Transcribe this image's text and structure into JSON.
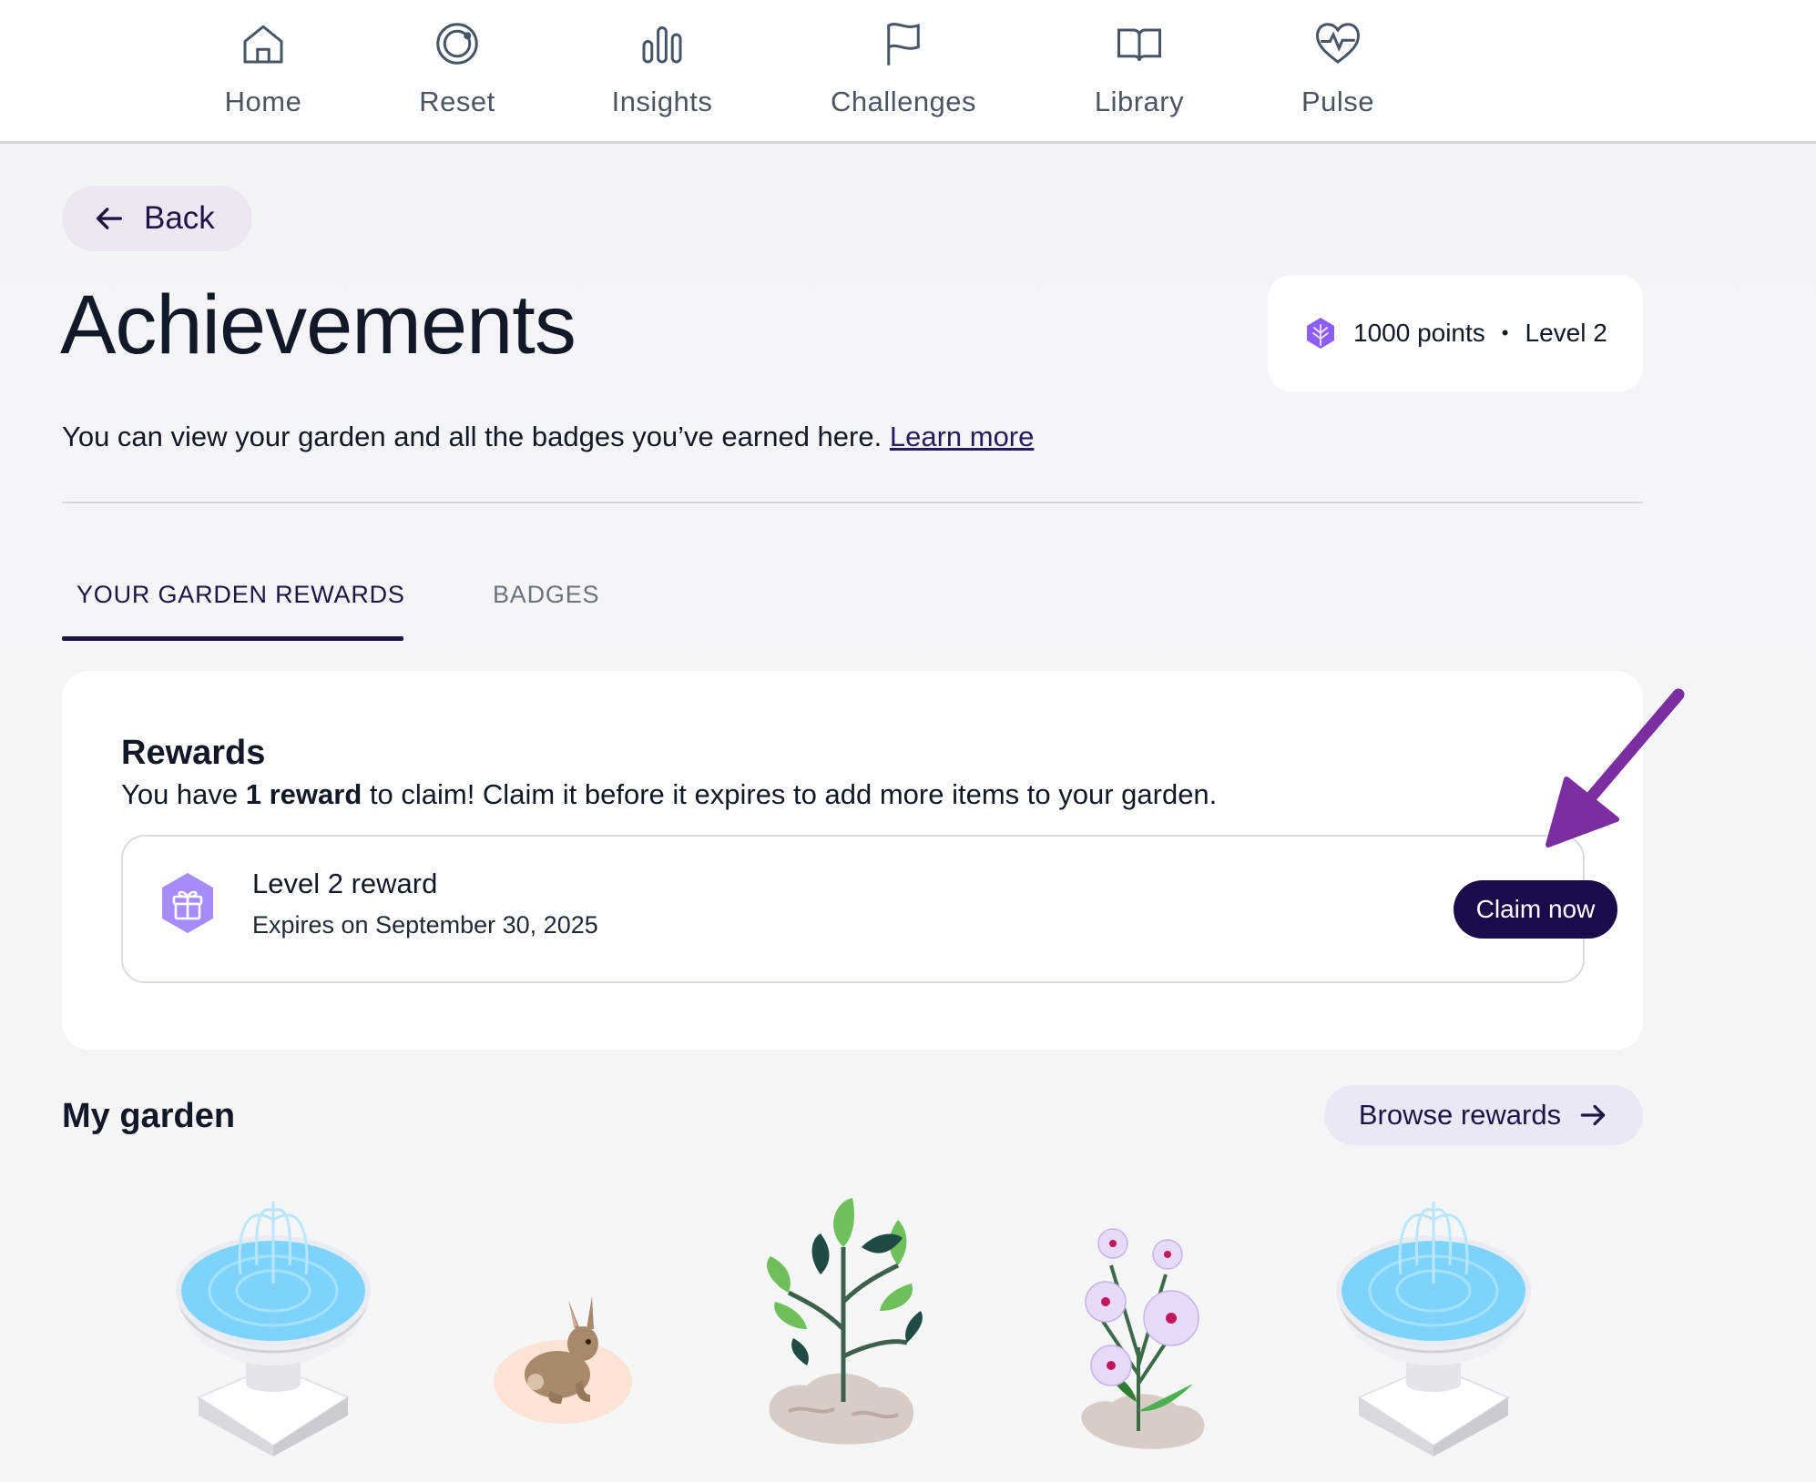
{
  "nav": {
    "items": [
      {
        "label": "Home",
        "icon": "home-icon"
      },
      {
        "label": "Reset",
        "icon": "reset-icon"
      },
      {
        "label": "Insights",
        "icon": "insights-icon"
      },
      {
        "label": "Challenges",
        "icon": "flag-icon"
      },
      {
        "label": "Library",
        "icon": "book-icon"
      },
      {
        "label": "Pulse",
        "icon": "heart-pulse-icon"
      }
    ]
  },
  "back": {
    "label": "Back",
    "icon": "arrow-left-icon"
  },
  "header": {
    "title": "Achievements",
    "subtitle": "You can view your garden and all the badges you’ve earned here.",
    "learn_more": "Learn more"
  },
  "points": {
    "icon": "leaf-icon",
    "points_text": "1000 points",
    "separator": "•",
    "level_text": "Level 2"
  },
  "tabs": [
    {
      "label": "YOUR GARDEN REWARDS",
      "active": true
    },
    {
      "label": "BADGES",
      "active": false
    }
  ],
  "rewards": {
    "heading": "Rewards",
    "desc_prefix": "You have ",
    "desc_bold": "1 reward",
    "desc_suffix": " to claim! Claim it before it expires to add more items to your garden.",
    "item": {
      "icon": "gift-icon",
      "title": "Level 2 reward",
      "expiry": "Expires on September 30, 2025",
      "claim_label": "Claim now"
    }
  },
  "garden": {
    "title": "My garden",
    "browse_label": "Browse rewards",
    "items": [
      "fountain",
      "rabbit",
      "plant",
      "flowers",
      "fountain"
    ]
  },
  "colors": {
    "primary": "#1b0b4a",
    "accent_purple": "#8b5cf6",
    "annotation_arrow": "#7b2ea0",
    "water": "#7dd3fc"
  }
}
